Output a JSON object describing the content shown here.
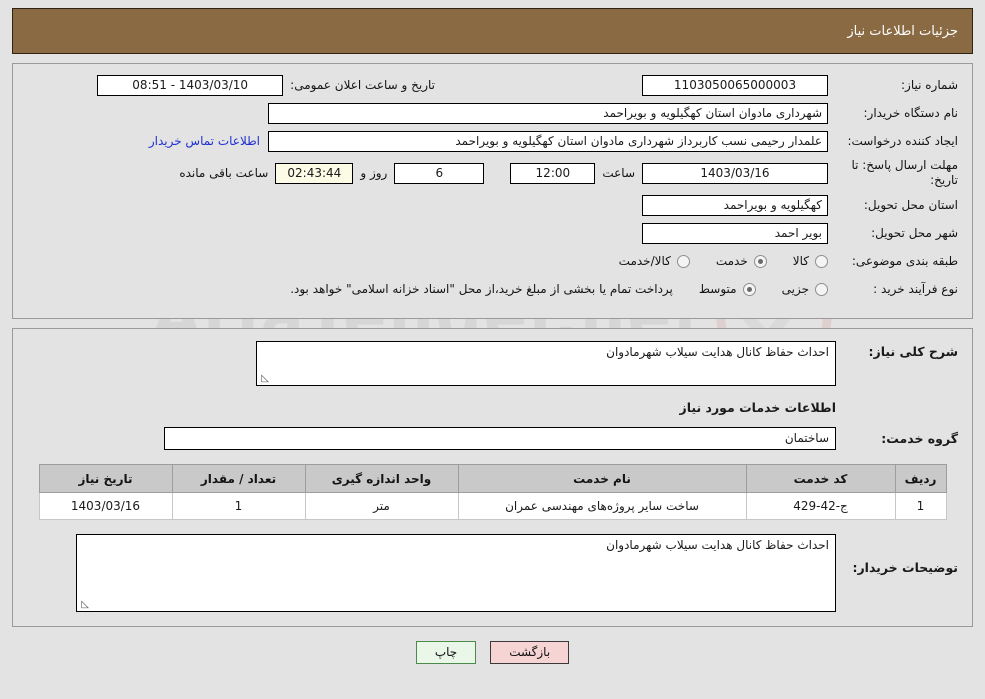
{
  "header": {
    "title": "جزئیات اطلاعات نیاز",
    "bar_color": "#8a6a42"
  },
  "watermark": {
    "text": "AriaTender.net"
  },
  "need_info": {
    "need_number_label": "شماره نیاز:",
    "need_number_value": "1103050065000003",
    "public_announce_label": "تاریخ و ساعت اعلان عمومی:",
    "public_announce_value": "1403/03/10 - 08:51",
    "buyer_org_label": "نام دستگاه خریدار:",
    "buyer_org_value": "شهرداری مادوان استان کهگیلویه و بویراحمد",
    "creator_label": "ایجاد کننده درخواست:",
    "creator_value": "علمدار رحیمی نسب کاربرداز شهرداری مادوان استان کهگیلویه و بویراحمد",
    "contact_link": "اطلاعات تماس خریدار",
    "deadline_label": "مهلت ارسال پاسخ: تا تاریخ:",
    "deadline_date": "1403/03/16",
    "hour_label": "ساعت",
    "deadline_time": "12:00",
    "days_remaining": "6",
    "days_label": "روز و",
    "countdown": "02:43:44",
    "countdown_label": "ساعت باقی مانده",
    "province_label": "استان محل تحویل:",
    "province_value": "کهگیلویه و بویراحمد",
    "city_label": "شهر محل تحویل:",
    "city_value": "بویر احمد",
    "category_label": "طبقه بندی موضوعی:",
    "category_options": [
      {
        "label": "کالا",
        "selected": false
      },
      {
        "label": "خدمت",
        "selected": true
      },
      {
        "label": "کالا/خدمت",
        "selected": false
      }
    ],
    "process_label": "نوع فرآیند خرید :",
    "process_options": [
      {
        "label": "جزیی",
        "selected": false
      },
      {
        "label": "متوسط",
        "selected": true
      }
    ],
    "payment_note": "پرداخت تمام یا بخشی از مبلغ خرید،از محل \"اسناد خزانه اسلامی\" خواهد بود."
  },
  "description": {
    "general_label": "شرح کلی نیاز:",
    "general_value": "احداث  حفاظ کانال هدایت سیلاب شهرمادوان",
    "services_section_title": "اطلاعات خدمات مورد نیاز",
    "service_group_label": "گروه خدمت:",
    "service_group_value": "ساختمان",
    "buyer_notes_label": "توضیحات خریدار:",
    "buyer_notes_value": "احداث  حفاظ کانال هدایت سیلاب شهرمادوان"
  },
  "table": {
    "headers": [
      "ردیف",
      "کد خدمت",
      "نام خدمت",
      "واحد اندازه گیری",
      "تعداد / مقدار",
      "تاریخ نیاز"
    ],
    "rows": [
      [
        "1",
        "ج-42-429",
        "ساخت سایر پروژه‌های مهندسی عمران",
        "متر",
        "1",
        "1403/03/16"
      ]
    ]
  },
  "buttons": {
    "back": "بازگشت",
    "print": "چاپ"
  }
}
